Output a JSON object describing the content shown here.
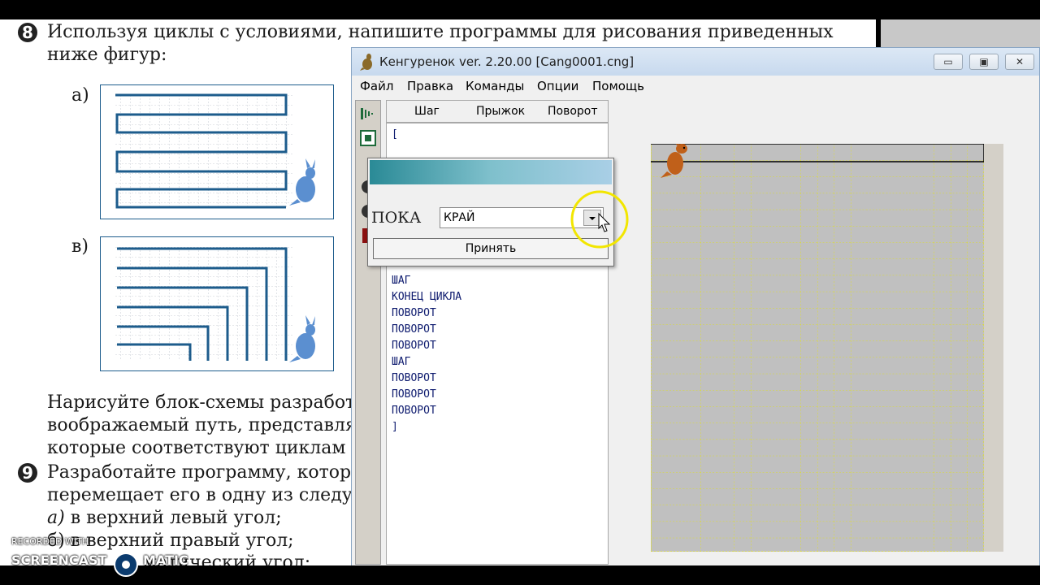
{
  "book": {
    "task8_num": "8",
    "task8_line1": "Используя циклы с условиями, напишите программы для рисования приведенных",
    "task8_line2": "ниже фигур:",
    "fig_a_label": "а)",
    "fig_b_label": "в)",
    "para_line1": "Нарисуйте блок-схемы разработанн",
    "para_line2": "воображаемый путь, представляю",
    "para_line3": "которые соответствуют циклам с ус",
    "task9_num": "9",
    "task9_line1": "Разработайте программу, которая н",
    "task9_line2": "перемещает его в одну из следующи",
    "task9_item_a_mark": "а)",
    "task9_item_a": " в верхний левый угол;",
    "task9_item_b": "б) в верхний правый угол;",
    "task9_item_c": "матический угол;"
  },
  "window": {
    "title": "Кенгуренок ver. 2.20.00  [Cang0001.cng]",
    "minimize": "▭",
    "maximize": "▣",
    "close": "✕"
  },
  "menu": [
    "Файл",
    "Правка",
    "Команды",
    "Опции",
    "Помощь"
  ],
  "toolbar_header": [
    "Шаг",
    "Прыжок",
    "Поворот"
  ],
  "code_lines_top": [
    "["
  ],
  "code_lines": [
    "ШАГ",
    "КОНЕЦ ЦИКЛА",
    "ПОВОРОТ",
    "ПОВОРОТ",
    "ПОВОРОТ",
    "ШАГ",
    "ПОВОРОТ",
    "ПОВОРОТ",
    "ПОВОРОТ",
    "]"
  ],
  "dialog": {
    "label": "ПОКА",
    "combo_value": "КРАЙ",
    "accept": "Принять"
  },
  "watermark": {
    "line1": "RECORDED WITH",
    "line2": "SCREENCAST",
    "line3": "MATIC"
  },
  "colors": {
    "figure_line": "#1d5c8c",
    "grid_line": "#e8e800",
    "field_bg": "#c0c0c0",
    "code_text": "#0d1a6e",
    "kangaroo": "#c0601a",
    "highlight": "#f2e600"
  },
  "icons": [
    "kangaroo-app-icon",
    "step-tool-icon",
    "stop-tool-icon",
    "dropdown-arrow-icon",
    "mouse-cursor-icon"
  ]
}
